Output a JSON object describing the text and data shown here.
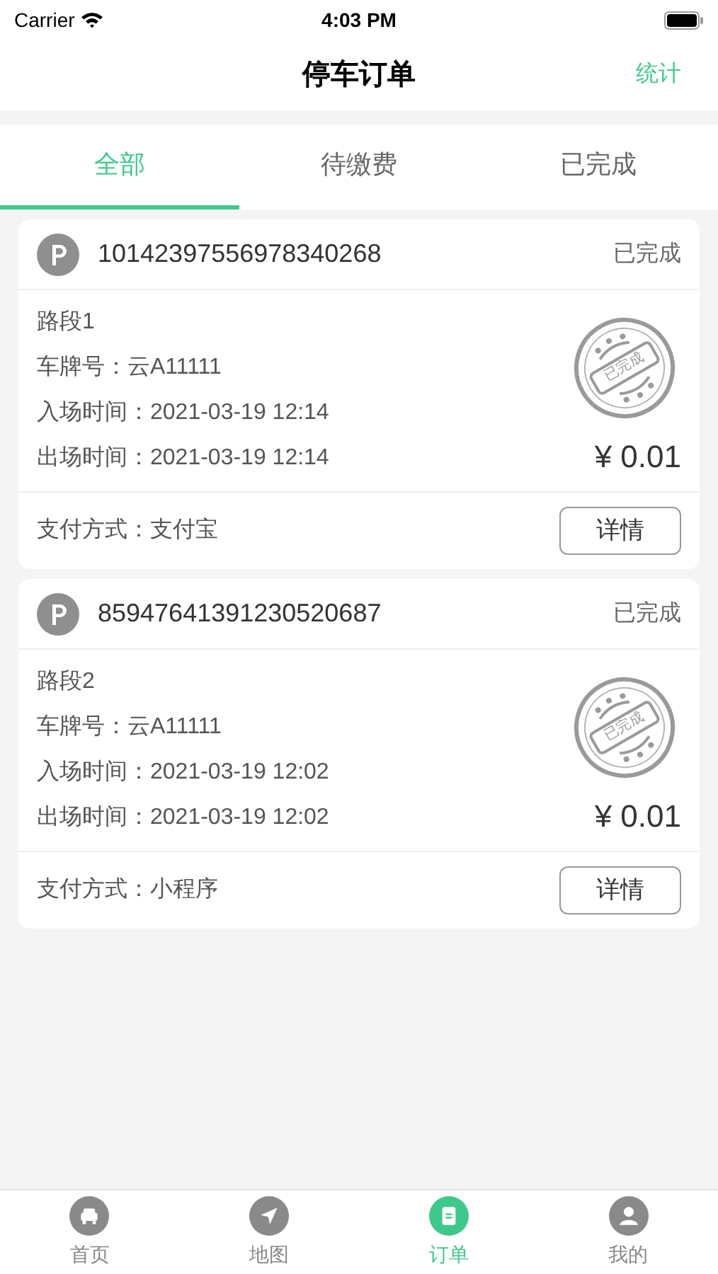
{
  "status_bar": {
    "carrier": "Carrier",
    "time": "4:03 PM"
  },
  "nav": {
    "title": "停车订单",
    "action": "统计"
  },
  "tabs": [
    {
      "label": "全部",
      "selected": true
    },
    {
      "label": "待缴费",
      "selected": false
    },
    {
      "label": "已完成",
      "selected": false
    }
  ],
  "orders": [
    {
      "order_no": "10142397556978340268",
      "status": "已完成",
      "road": "路段1",
      "plate_label": "车牌号：",
      "plate": "云A11111",
      "entry_label": "入场时间：",
      "entry_time": "2021-03-19 12:14",
      "exit_label": "出场时间：",
      "exit_time": "2021-03-19 12:14",
      "stamp": "已完成",
      "amount": "¥ 0.01",
      "pay_label": "支付方式：",
      "pay_method": "支付宝",
      "button": "详情"
    },
    {
      "order_no": "85947641391230520687",
      "status": "已完成",
      "road": "路段2",
      "plate_label": "车牌号：",
      "plate": "云A11111",
      "entry_label": "入场时间：",
      "entry_time": "2021-03-19 12:02",
      "exit_label": "出场时间：",
      "exit_time": "2021-03-19 12:02",
      "stamp": "已完成",
      "amount": "¥ 0.01",
      "pay_label": "支付方式：",
      "pay_method": "小程序",
      "button": "详情"
    }
  ],
  "tab_bar": [
    {
      "label": "首页",
      "kind": "car",
      "selected": false
    },
    {
      "label": "地图",
      "kind": "navigate",
      "selected": false
    },
    {
      "label": "订单",
      "kind": "order",
      "selected": true
    },
    {
      "label": "我的",
      "kind": "user",
      "selected": false
    }
  ]
}
